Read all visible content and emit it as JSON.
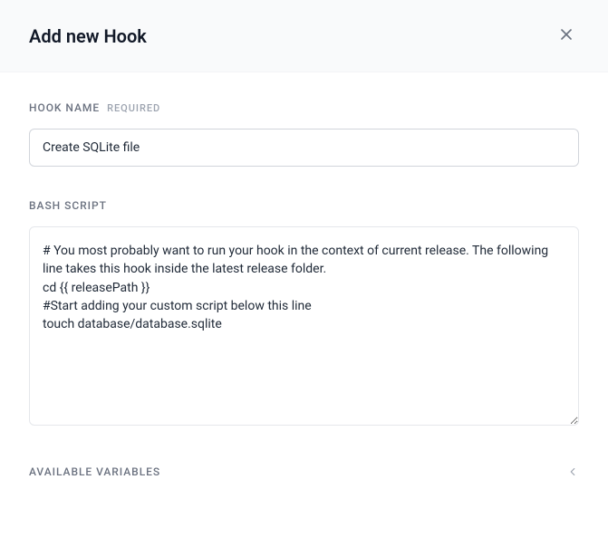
{
  "header": {
    "title": "Add new Hook"
  },
  "form": {
    "hookName": {
      "label": "HOOK NAME",
      "requiredLabel": "REQUIRED",
      "value": "Create SQLite file"
    },
    "bashScript": {
      "label": "BASH SCRIPT",
      "value": "# You most probably want to run your hook in the context of current release. The following line takes this hook inside the latest release folder.\ncd {{ releasePath }}\n#Start adding your custom script below this line\ntouch database/database.sqlite"
    },
    "availableVariables": {
      "label": "AVAILABLE VARIABLES",
      "expanded": false
    }
  }
}
